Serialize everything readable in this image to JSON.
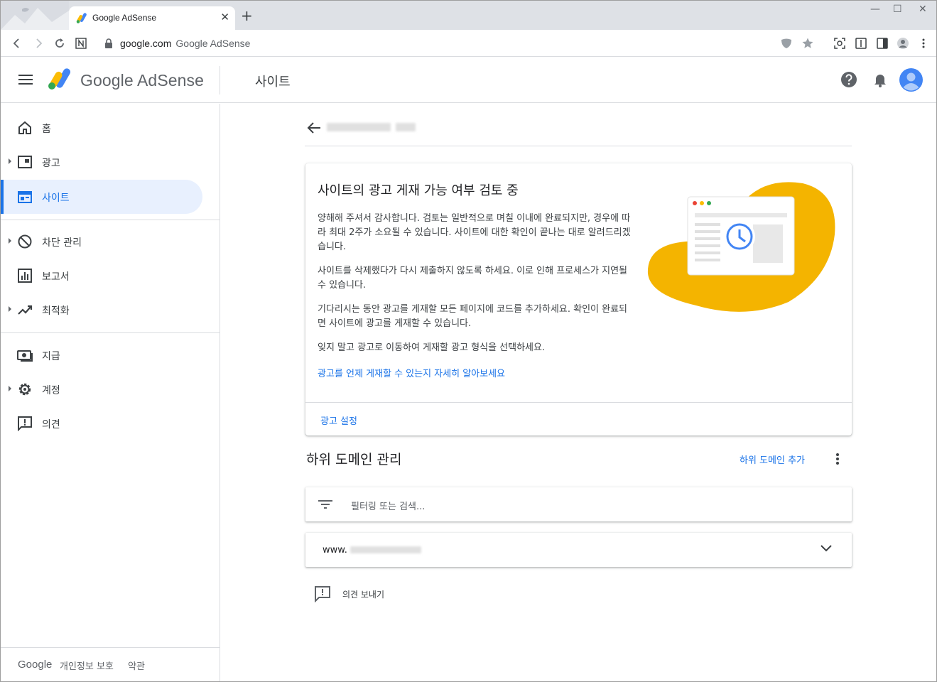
{
  "browser": {
    "tab_title": "Google AdSense",
    "tab_close": "✕",
    "new_tab": "+",
    "url_host": "google.com",
    "url_page_title": "Google AdSense",
    "window_controls": [
      "—",
      "☐",
      "✕"
    ]
  },
  "header": {
    "brand": "Google AdSense",
    "page_title": "사이트"
  },
  "sidebar": {
    "items": [
      {
        "label": "홈",
        "icon": "home-icon"
      },
      {
        "label": "광고",
        "icon": "ads-icon"
      },
      {
        "label": "사이트",
        "icon": "sites-icon"
      },
      {
        "label": "차단 관리",
        "icon": "block-icon"
      },
      {
        "label": "보고서",
        "icon": "reports-icon"
      },
      {
        "label": "최적화",
        "icon": "optimize-icon"
      },
      {
        "label": "지급",
        "icon": "payments-icon"
      },
      {
        "label": "계정",
        "icon": "account-gear-icon"
      },
      {
        "label": "의견",
        "icon": "feedback-icon"
      }
    ],
    "footer": {
      "google": "Google",
      "privacy": "개인정보 보호",
      "terms": "약관"
    }
  },
  "review_card": {
    "title": "사이트의 광고 게재 가능 여부 검토 중",
    "p1": "양해해 주셔서 감사합니다. 검토는 일반적으로 며칠 이내에 완료되지만, 경우에 따라 최대 2주가 소요될 수 있습니다. 사이트에 대한 확인이 끝나는 대로 알려드리겠습니다.",
    "p2": "사이트를 삭제했다가 다시 제출하지 않도록 하세요. 이로 인해 프로세스가 지연될 수 있습니다.",
    "p3": "기다리시는 동안 광고를 게재할 모든 페이지에 코드를 추가하세요. 확인이 완료되면 사이트에 광고를 게재할 수 있습니다.",
    "p4": "잊지 말고 광고로 이동하여 게재할 광고 형식을 선택하세요.",
    "learn_more": "광고를 언제 게재할 수 있는지 자세히 알아보세요",
    "footer_link": "광고 설정"
  },
  "subdomains": {
    "title": "하위 도메인 관리",
    "add_label": "하위 도메인 추가",
    "filter_placeholder": "필터링 또는 검색...",
    "row_prefix": "www."
  },
  "feedback": {
    "label": "의견 보내기"
  },
  "colors": {
    "accent": "#1a73e8",
    "active_bg": "#e8f0fe",
    "illustration_blob": "#f4b400"
  }
}
